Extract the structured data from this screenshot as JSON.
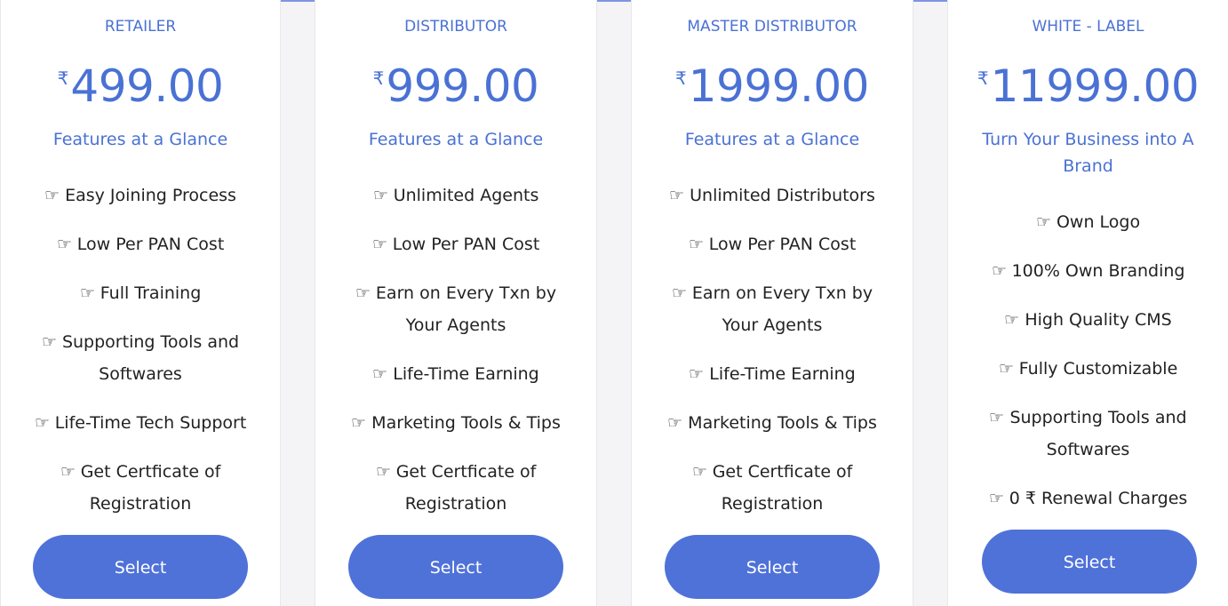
{
  "currency_symbol": "₹",
  "hand_icon": "pointing-hand-icon",
  "accent_color": "#4a71d4",
  "button_color": "#4f72d9",
  "plans": [
    {
      "name": "RETAILER",
      "price": "499.00",
      "subtitle": "Features at a Glance",
      "features": [
        "Easy Joining Process",
        "Low Per PAN Cost",
        "Full Training",
        "Supporting Tools and Softwares",
        "Life-Time Tech Support",
        "Get Certficate of Registration"
      ],
      "button_label": "Select"
    },
    {
      "name": "DISTRIBUTOR",
      "price": "999.00",
      "subtitle": "Features at a Glance",
      "features": [
        "Unlimited Agents",
        "Low Per PAN Cost",
        "Earn on Every Txn by Your Agents",
        "Life-Time Earning",
        "Marketing Tools & Tips",
        "Get Certficate of Registration"
      ],
      "button_label": "Select"
    },
    {
      "name": "MASTER DISTRIBUTOR",
      "price": "1999.00",
      "subtitle": "Features at a Glance",
      "features": [
        "Unlimited Distributors",
        "Low Per PAN Cost",
        "Earn on Every Txn by Your Agents",
        "Life-Time Earning",
        "Marketing Tools & Tips",
        "Get Certficate of Registration"
      ],
      "button_label": "Select"
    },
    {
      "name": "WHITE - LABEL",
      "price": "11999.00",
      "subtitle": "Turn Your Business into A Brand",
      "features": [
        "Own Logo",
        "100% Own Branding",
        "High Quality CMS",
        "Fully Customizable",
        "Supporting Tools and Softwares",
        "0 ₹ Renewal Charges"
      ],
      "button_label": "Select"
    }
  ]
}
